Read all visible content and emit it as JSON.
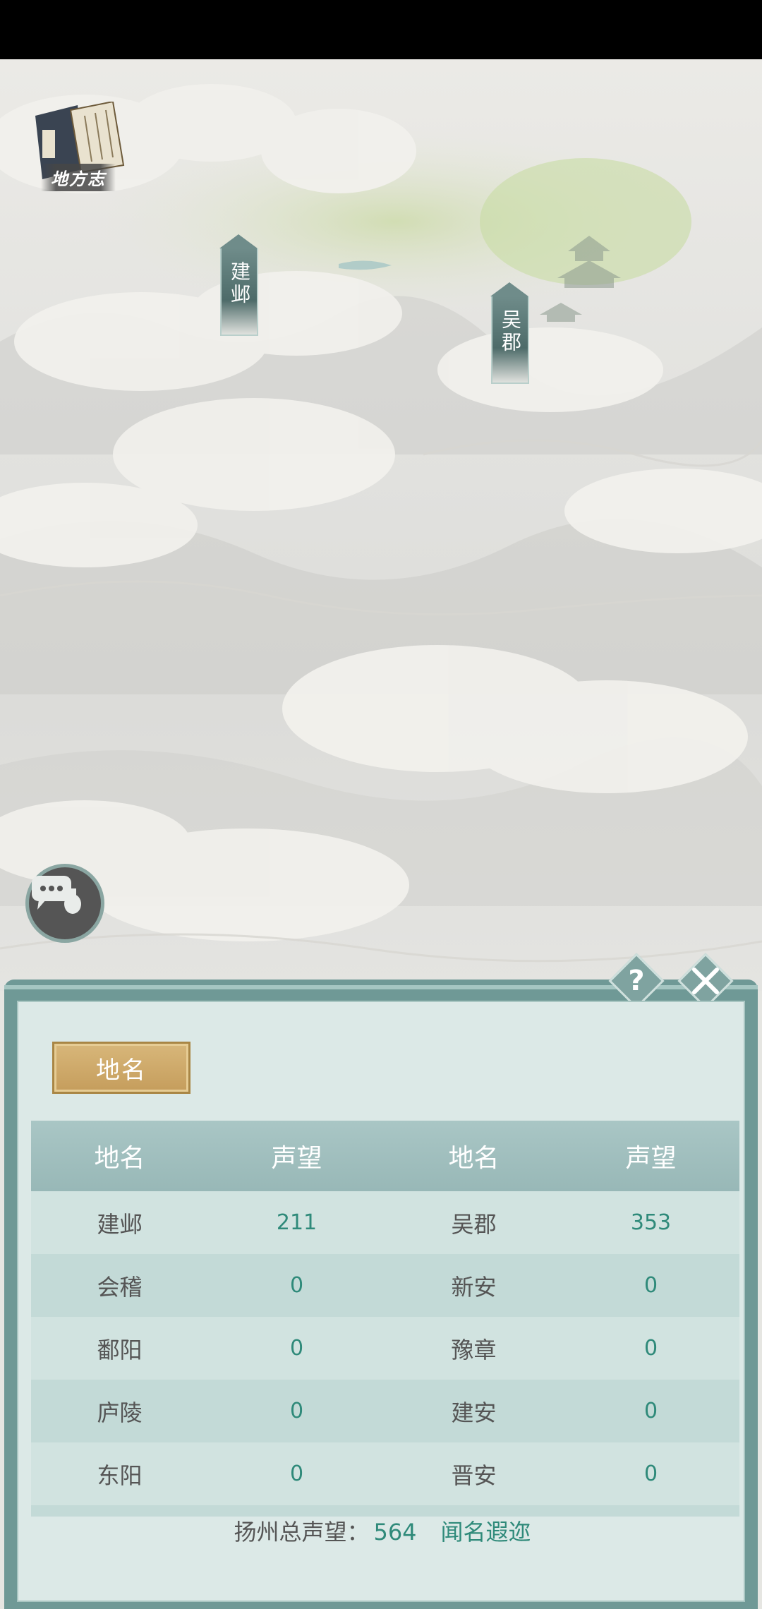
{
  "map": {
    "atlas_label": "地方志",
    "cities": [
      {
        "name": "建邺"
      },
      {
        "name": "吴郡"
      }
    ]
  },
  "icons": {
    "atlas": "book-icon",
    "chat": "chat-bubble-icon",
    "help": "question-icon",
    "close": "close-icon"
  },
  "panel": {
    "help_label": "?",
    "tab_label": "地名",
    "table": {
      "headers": [
        "地名",
        "声望",
        "地名",
        "声望"
      ],
      "rows": [
        {
          "name1": "建邺",
          "rep1": "211",
          "name2": "吴郡",
          "rep2": "353"
        },
        {
          "name1": "会稽",
          "rep1": "0",
          "name2": "新安",
          "rep2": "0"
        },
        {
          "name1": "鄱阳",
          "rep1": "0",
          "name2": "豫章",
          "rep2": "0"
        },
        {
          "name1": "庐陵",
          "rep1": "0",
          "name2": "建安",
          "rep2": "0"
        },
        {
          "name1": "东阳",
          "rep1": "0",
          "name2": "晋安",
          "rep2": "0"
        }
      ]
    },
    "footer": {
      "label": "扬州总声望：",
      "value": "564",
      "rank": "闻名遐迩"
    }
  },
  "colors": {
    "accent": "#2f8a7a",
    "panel_frame": "#6f9996",
    "tab_gold": "#c59d5c"
  }
}
